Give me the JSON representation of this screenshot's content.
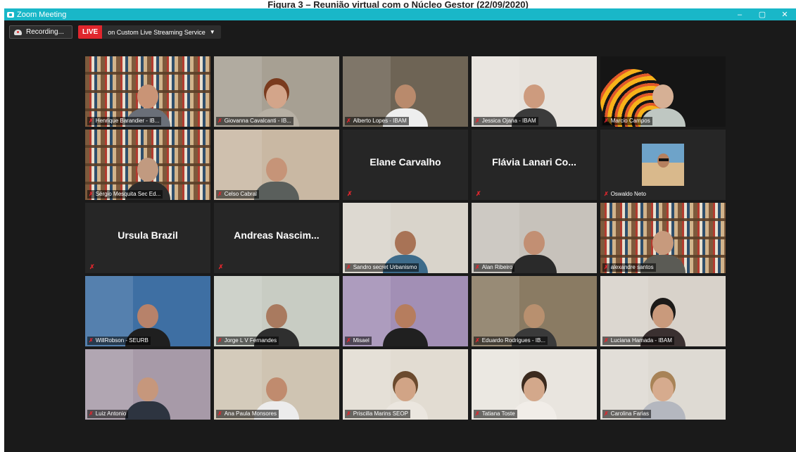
{
  "caption": "Figura 3 – Reunião virtual com o Núcleo Gestor (22/09/2020)",
  "window": {
    "title": "Zoom Meeting",
    "controls": {
      "minimize": "‒",
      "restore": "▢",
      "close": "✕"
    }
  },
  "toolbar": {
    "recording_label": "Recording...",
    "live_badge": "LIVE",
    "live_text": "on Custom Live Streaming Service",
    "live_caret": "▼"
  },
  "participants": [
    {
      "name": "Henrique Barandier - IB...",
      "video": true,
      "scene": "bookshelf",
      "skin": "#c99476",
      "shirt": "#6a6f78",
      "bg": "#d8d1c4"
    },
    {
      "name": "Giovanna Cavalcanti - IB...",
      "video": true,
      "scene": "room",
      "skin": "#d3a58a",
      "shirt": "#b7b0a4",
      "bg": "#a7a093",
      "hair": "#7a3b1e"
    },
    {
      "name": "Alberto Lopes - IBAM",
      "video": true,
      "scene": "room",
      "skin": "#b98a6c",
      "shirt": "#eeeeee",
      "bg": "#6e6455"
    },
    {
      "name": "Jessica Ojana - IBAM",
      "video": true,
      "scene": "room",
      "skin": "#cd9b7e",
      "shirt": "#3b3b3b",
      "bg": "#e6e2dc"
    },
    {
      "name": "Marcio Campos",
      "video": true,
      "scene": "logo",
      "skin": "#d6b095",
      "shirt": "#bfc7c2",
      "bg": "#151515"
    },
    {
      "name": "Sérgio Mesquita Sec Ed...",
      "video": true,
      "scene": "bookshelf",
      "skin": "#c19a80",
      "shirt": "#2b2b2b",
      "bg": "#cfc6b7"
    },
    {
      "name": "Celso Cabral",
      "video": true,
      "scene": "room",
      "skin": "#c69478",
      "shirt": "#5a5f5c",
      "bg": "#c9b8a3",
      "active": true
    },
    {
      "name": "Elane Carvalho",
      "video": false
    },
    {
      "name": "Flávia Lanari Co...",
      "video": false
    },
    {
      "name": "Oswaldo Neto",
      "video": false,
      "thumbnail": true
    },
    {
      "name": "Ursula Brazil",
      "video": false
    },
    {
      "name": "Andreas Nascim...",
      "video": false
    },
    {
      "name": "Sandro secret Urbanismo",
      "video": true,
      "scene": "room",
      "skin": "#a87356",
      "shirt": "#3d6b8a",
      "bg": "#d9d4cb"
    },
    {
      "name": "Alan Ribeiro",
      "video": true,
      "scene": "room",
      "skin": "#c28f73",
      "shirt": "#2a2a2a",
      "bg": "#c7c2bb"
    },
    {
      "name": "alexandre santos",
      "video": true,
      "scene": "bookshelf",
      "skin": "#c79a7d",
      "shirt": "#5b5b55",
      "bg": "#bcae94"
    },
    {
      "name": "WillRobson - SEURB",
      "video": true,
      "scene": "room",
      "skin": "#b7826a",
      "shirt": "#1f1f1f",
      "bg": "#3e6fa3"
    },
    {
      "name": "Jorge L V Fernandes",
      "video": true,
      "scene": "room",
      "skin": "#a97a5f",
      "shirt": "#2f2f2f",
      "bg": "#c8ccc3"
    },
    {
      "name": "Misael",
      "video": true,
      "scene": "room",
      "skin": "#b67d5e",
      "shirt": "#202020",
      "bg": "#a28fb5"
    },
    {
      "name": "Eduardo Rodrigues - IB...",
      "video": true,
      "scene": "room",
      "skin": "#b8906f",
      "shirt": "#3a3a3a",
      "bg": "#8a7b63"
    },
    {
      "name": "Luciana Hamada - IBAM",
      "video": true,
      "scene": "room",
      "skin": "#c99a7c",
      "shirt": "#3a3030",
      "bg": "#d8d2ca",
      "hair": "#1c1a18"
    },
    {
      "name": "Luiz Antonio",
      "video": true,
      "scene": "room",
      "skin": "#c6977c",
      "shirt": "#2d3440",
      "bg": "#a79aa8"
    },
    {
      "name": "Ana Paula Monsores",
      "video": true,
      "scene": "room",
      "skin": "#c08b6e",
      "shirt": "#ececec",
      "bg": "#cfc4b2"
    },
    {
      "name": "Priscilla Marins SEOP",
      "video": true,
      "scene": "room",
      "skin": "#d1a486",
      "shirt": "#ebe6df",
      "bg": "#e2dcd2",
      "hair": "#6b4a2e"
    },
    {
      "name": "Tatiana Toste",
      "video": true,
      "scene": "room",
      "skin": "#d3a88b",
      "shirt": "#f1ede8",
      "bg": "#e9e5df",
      "hair": "#3b2a1e"
    },
    {
      "name": "Carolina Farias",
      "video": true,
      "scene": "room",
      "skin": "#d6ab8e",
      "shirt": "#b4b7bf",
      "bg": "#dedad3",
      "hair": "#a88357"
    }
  ]
}
